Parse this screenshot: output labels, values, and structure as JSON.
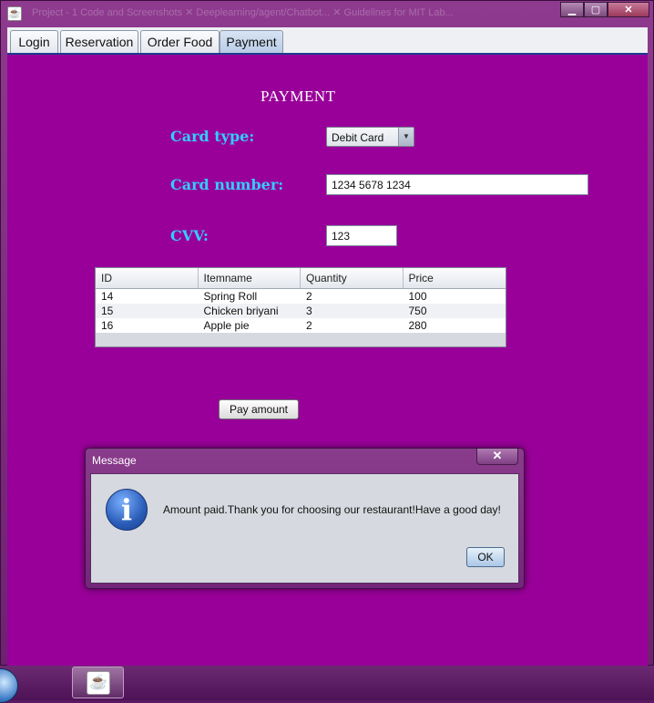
{
  "window": {
    "title_ghost": "Project - 1 Code and Screenshots    ✕    Deeplearning/agent/Chatbot...    ✕    Guidelines for MIT Lab..."
  },
  "tabs": [
    {
      "label": "Login",
      "active": false
    },
    {
      "label": "Reservation",
      "active": false
    },
    {
      "label": "Order Food",
      "active": false
    },
    {
      "label": "Payment",
      "active": true
    }
  ],
  "payment": {
    "heading": "PAYMENT",
    "card_type_label": "Card type:",
    "card_type_value": "Debit Card",
    "card_number_label": "Card number:",
    "card_number_value": "1234 5678 1234",
    "cvv_label": "CVV:",
    "cvv_value": "123",
    "pay_button": "Pay amount"
  },
  "table": {
    "headers": [
      "ID",
      "Itemname",
      "Quantity",
      "Price"
    ],
    "rows": [
      [
        "14",
        "Spring Roll",
        "2",
        "100"
      ],
      [
        "15",
        "Chicken briyani",
        "3",
        "750"
      ],
      [
        "16",
        "Apple pie",
        "2",
        "280"
      ]
    ]
  },
  "dialog": {
    "title": "Message",
    "close": "✕",
    "message": "Amount paid.Thank you for choosing our restaurant!Have a good day!",
    "ok": "OK",
    "icon": "info-icon"
  },
  "colors": {
    "panel_bg": "#990099",
    "label": "#33ccff"
  }
}
